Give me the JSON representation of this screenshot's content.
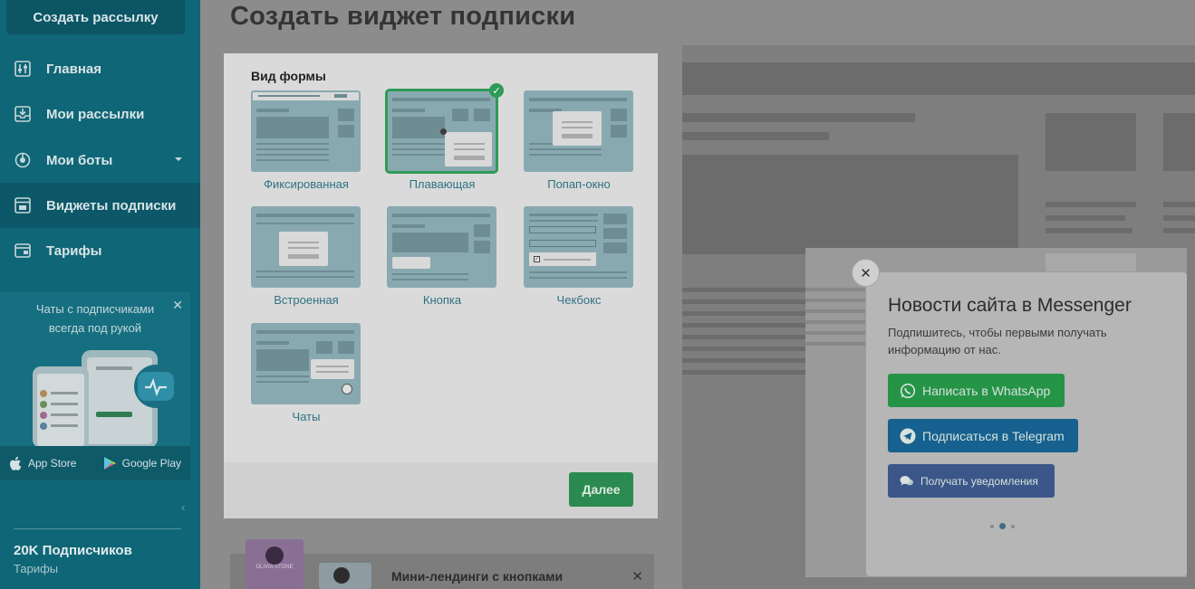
{
  "sidebar": {
    "create_label": "Создать рассылку",
    "items": [
      {
        "label": "Главная",
        "icon": "sliders-icon"
      },
      {
        "label": "Мои рассылки",
        "icon": "inbox-icon"
      },
      {
        "label": "Мои боты",
        "icon": "bot-icon"
      },
      {
        "label": "Виджеты подписки",
        "icon": "widget-icon"
      },
      {
        "label": "Тарифы",
        "icon": "card-icon"
      }
    ],
    "promo": {
      "text": "Чаты с подписчиками всегда под рукой",
      "close": "✕",
      "app_store": "App Store",
      "google_play": "Google Play"
    },
    "collapse": "‹",
    "subscribers": "20K Подписчиков",
    "tariff": "Тарифы"
  },
  "main": {
    "title": "Создать виджет подписки",
    "form_label": "Вид формы",
    "options": [
      {
        "label": "Фиксированная",
        "selected": false
      },
      {
        "label": "Плавающая",
        "selected": true
      },
      {
        "label": "Попап-окно",
        "selected": false
      },
      {
        "label": "Встроенная",
        "selected": false
      },
      {
        "label": "Кнопка",
        "selected": false
      },
      {
        "label": "Чекбокс",
        "selected": false
      },
      {
        "label": "Чаты",
        "selected": false
      }
    ],
    "next_label": "Далее",
    "bottom_card": {
      "title": "Мини-лендинги с кнопками",
      "thumb_text": "OLIVIA STONE",
      "close": "✕"
    }
  },
  "preview": {
    "close": "✕",
    "title": "Новости сайта в Messenger",
    "subtitle": "Подпишитесь, чтобы первыми получать информацию от нас.",
    "buttons": {
      "whatsapp": "Написать в WhatsApp",
      "telegram": "Подписаться в Telegram",
      "messenger": "Получать уведомления"
    }
  },
  "colors": {
    "sidebar": "#0f6676",
    "accent_green": "#2b8a4f",
    "whatsapp": "#259447",
    "telegram": "#16618f",
    "messenger": "#3b5689"
  }
}
